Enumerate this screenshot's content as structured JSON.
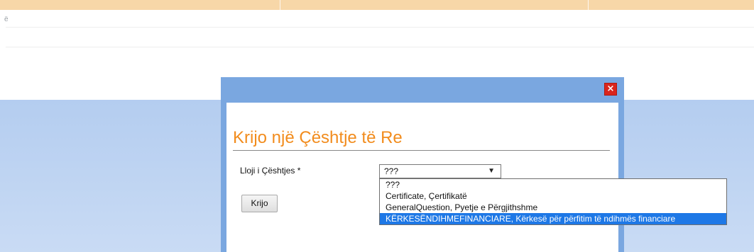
{
  "background": {
    "side_char": "ë"
  },
  "dialog": {
    "close_glyph": "×",
    "title": "Krijo një Çështje të Re",
    "field_label": "Lloji i Çështjes *",
    "select": {
      "selected": "???",
      "options": [
        "???",
        "Certificate, Çertifikatë",
        "GeneralQuestion, Pyetje e Përgjithshme",
        "KËRKESËNDIHMEFINANCIARE, Kërkesë për përfitim të ndihmës financiare"
      ],
      "highlighted_index": 3
    },
    "submit_label": "Krijo"
  },
  "colors": {
    "title": "#f28c1d",
    "dialog_frame": "#7aa7e0",
    "highlight": "#1e78e6",
    "close_button": "#d9251c",
    "top_bar": "#f7d7a8"
  }
}
